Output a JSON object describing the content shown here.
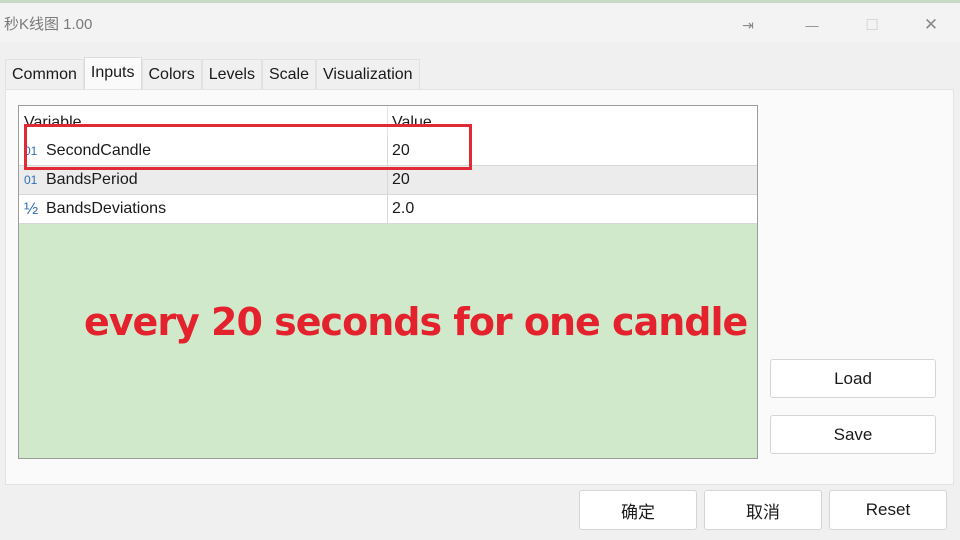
{
  "window": {
    "title": "秒K线图 1.00",
    "controls": {
      "pin": "⇥",
      "minimize": "—",
      "maximize": "☐",
      "close": "✕"
    }
  },
  "tabs": [
    {
      "label": "Common",
      "active": false
    },
    {
      "label": "Inputs",
      "active": true
    },
    {
      "label": "Colors",
      "active": false
    },
    {
      "label": "Levels",
      "active": false
    },
    {
      "label": "Scale",
      "active": false
    },
    {
      "label": "Visualization",
      "active": false
    }
  ],
  "table": {
    "headers": [
      "Variable",
      "Value"
    ],
    "rows": [
      {
        "type_icon": "01",
        "type": "integer",
        "variable": "SecondCandle",
        "value": "20"
      },
      {
        "type_icon": "01",
        "type": "integer",
        "variable": "BandsPeriod",
        "value": "20"
      },
      {
        "type_icon": "½",
        "type": "double",
        "variable": "BandsDeviations",
        "value": "2.0"
      }
    ]
  },
  "annotation": "every 20 seconds for one candle",
  "side_buttons": {
    "load": "Load",
    "save": "Save"
  },
  "footer_buttons": {
    "ok": "确定",
    "cancel": "取消",
    "reset": "Reset"
  },
  "colors": {
    "highlight": "#e02b36",
    "annotation": "#e3222d",
    "grid_bg": "#d0e9cb",
    "type_icon": "#2f6fb5"
  }
}
